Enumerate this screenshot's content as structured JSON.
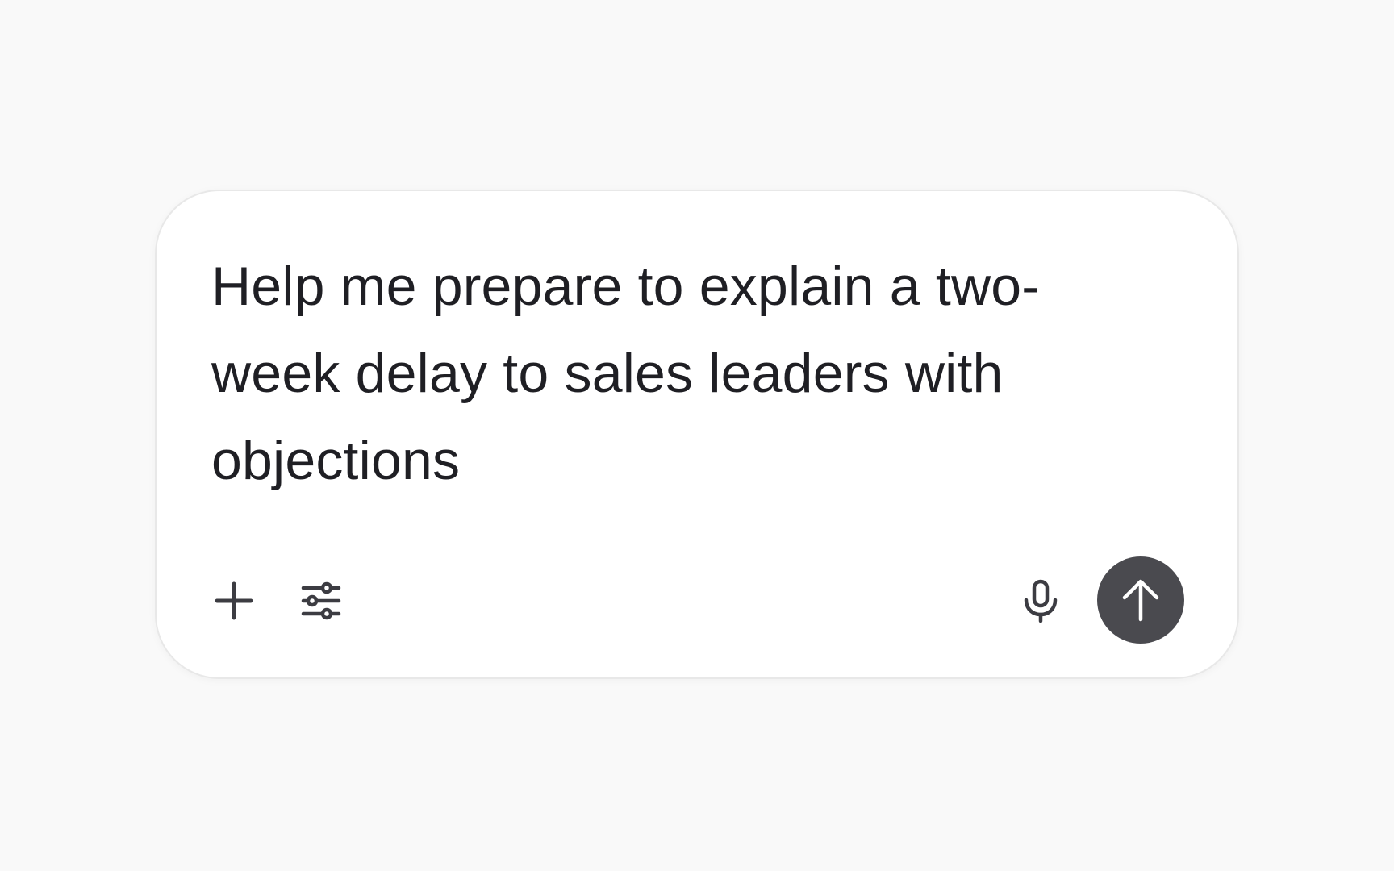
{
  "composer": {
    "prompt_text": "Help me prepare to explain a two-week delay to sales leaders with objections"
  },
  "toolbar": {
    "add_icon": "plus-icon",
    "tools_icon": "sliders-icon",
    "mic_icon": "microphone-icon",
    "send_icon": "arrow-up-icon"
  },
  "colors": {
    "page_background": "#f9f9f9",
    "composer_background": "#ffffff",
    "text": "#1f1f24",
    "icon": "#3c3c42",
    "send_button": "#4a4a4f",
    "send_icon": "#ffffff"
  }
}
